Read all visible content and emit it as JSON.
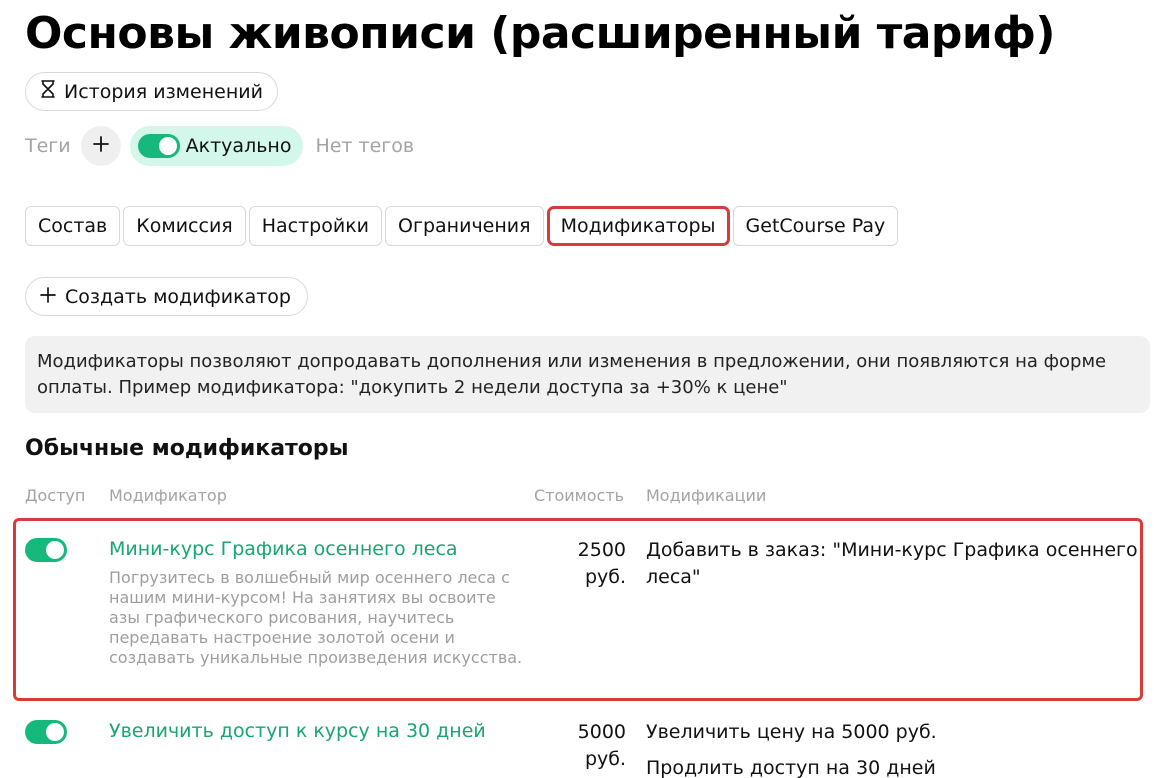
{
  "page": {
    "title": "Основы живописи (расширенный тариф)"
  },
  "history_button": {
    "label": "История изменений",
    "icon": "hourglass-icon"
  },
  "tags": {
    "label": "Теги",
    "add_icon": "plus-icon",
    "actual_label": "Актуально",
    "actual_on": true,
    "empty_text": "Нет тегов"
  },
  "tabs": [
    {
      "label": "Состав",
      "active": false
    },
    {
      "label": "Комиссия",
      "active": false
    },
    {
      "label": "Настройки",
      "active": false
    },
    {
      "label": "Ограничения",
      "active": false
    },
    {
      "label": "Модификаторы",
      "active": true
    },
    {
      "label": "GetCourse Pay",
      "active": false
    }
  ],
  "create_button": {
    "label": "Создать модификатор",
    "icon": "plus-icon"
  },
  "info_text": "Модификаторы позволяют допродавать дополнения или изменения в предложении, они появляются на форме оплаты. Пример модификатора: \"докупить 2 недели доступа за +30% к цене\"",
  "section": {
    "title": "Обычные модификаторы"
  },
  "table": {
    "headers": {
      "access": "Доступ",
      "modifier": "Модификатор",
      "cost": "Стоимость",
      "changes": "Модификации"
    },
    "rows": [
      {
        "enabled": true,
        "name": "Мини-курс Графика осеннего леса",
        "description": "Погрузитесь в волшебный мир осеннего леса с нашим мини-курсом! На занятиях вы освоите азы графического рисования, научитесь передавать настроение золотой осени и создавать уникальные произведения искусства.",
        "price_amount": "2500",
        "price_unit": "руб.",
        "changes": [
          "Добавить в заказ: \"Мини-курс Графика осеннего леса\""
        ]
      },
      {
        "enabled": true,
        "name": "Увеличить доступ к курсу на 30 дней",
        "description": "",
        "price_amount": "5000",
        "price_unit": "руб.",
        "changes": [
          "Увеличить цену на 5000 руб.",
          "Продлить доступ на 30 дней"
        ]
      }
    ]
  },
  "colors": {
    "accent_green": "#17b87b",
    "link_green": "#17a572",
    "highlight_red": "#d93b3b",
    "actual_pill_bg": "#d3f7ea"
  }
}
